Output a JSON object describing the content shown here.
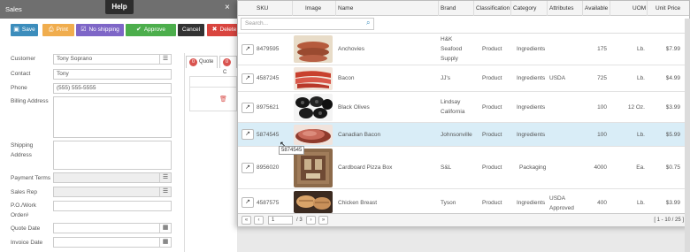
{
  "window": {
    "title": "Sales",
    "help_tab": "Help",
    "close_glyph": "×"
  },
  "toolbar": {
    "save": "Save",
    "print": "Print",
    "no_shipping": "No shipping",
    "approve": "Approve",
    "cancel": "Cancel",
    "delete": "Delete"
  },
  "form": {
    "customer_label": "Customer",
    "customer_value": "Tony Soprano",
    "contact_label": "Contact",
    "contact_value": "Tony",
    "phone_label": "Phone",
    "phone_value": "(555) 555-5555",
    "billing_label": "Billing Address",
    "shipping_label_1": "Shipping",
    "shipping_label_2": "Address",
    "payment_label": "Payment Terms",
    "salesrep_label": "Sales Rep",
    "po_label_1": "P.O./Work",
    "po_label_2": "Order#",
    "quote_date_label": "Quote Date",
    "invoice_date_label": "Invoice Date"
  },
  "tabs": {
    "quote_count": "0",
    "quote_label": "Quote",
    "second_count": "0",
    "second_label": "C"
  },
  "grid": {
    "headers": {
      "sku": "SKU",
      "image": "Image",
      "name": "Name",
      "brand": "Brand",
      "classification": "Classification",
      "category": "Category",
      "attributes": "Attributes",
      "available": "Available",
      "uom": "UOM",
      "unit_price": "Unit Price"
    },
    "search_placeholder": "Search...",
    "rows": [
      {
        "sku": "8479595",
        "name": "Anchovies",
        "brand_1": "H&K",
        "brand_2": "Seafood",
        "brand_3": "Supply",
        "classification": "Product",
        "category": "Ingredients",
        "attributes": "",
        "available": "175",
        "uom": "Lb.",
        "price": "$7.99"
      },
      {
        "sku": "4587245",
        "name": "Bacon",
        "brand_1": "JJ's",
        "brand_2": "",
        "brand_3": "",
        "classification": "Product",
        "category": "Ingredients",
        "attributes": "USDA",
        "available": "725",
        "uom": "Lb.",
        "price": "$4.99"
      },
      {
        "sku": "8975621",
        "name": "Black Olives",
        "brand_1": "Lindsay",
        "brand_2": "California",
        "brand_3": "",
        "classification": "Product",
        "category": "Ingredients",
        "attributes": "",
        "available": "100",
        "uom": "12 Oz.",
        "price": "$3.99"
      },
      {
        "sku": "5874545",
        "name": "Canadian Bacon",
        "brand_1": "Johnsonville",
        "brand_2": "",
        "brand_3": "",
        "classification": "Product",
        "category": "Ingredients",
        "attributes": "",
        "available": "100",
        "uom": "Lb.",
        "price": "$5.99"
      },
      {
        "sku": "8956020",
        "name": "Cardboard Pizza Box",
        "brand_1": "S&L",
        "brand_2": "",
        "brand_3": "",
        "classification": "Product",
        "category": "Packaging",
        "attributes": "",
        "available": "4000",
        "uom": "Ea.",
        "price": "$0.75"
      },
      {
        "sku": "4587575",
        "name": "Chicken Breast",
        "brand_1": "Tyson",
        "brand_2": "",
        "brand_3": "",
        "classification": "Product",
        "category": "Ingredients",
        "attributes_1": "USDA",
        "attributes_2": "Approved",
        "available": "400",
        "uom": "Lb.",
        "price": "$3.99"
      }
    ],
    "tooltip": "5874545"
  },
  "pager": {
    "first": "«",
    "prev": "‹",
    "page": "1",
    "of": "/ 3",
    "next": "›",
    "last": "»",
    "info": "[ 1 - 10 / 25 ]"
  },
  "colors": {
    "save": "#3c8dbc",
    "print": "#f0ad4e",
    "noship": "#7e66c7",
    "approve": "#4cae4c",
    "cancel": "#333333",
    "delete": "#d9453f",
    "selected_row": "#d9edf7"
  },
  "icons": [
    "save-icon",
    "print-icon",
    "no-shipping-icon",
    "check-icon",
    "close-icon",
    "trash-icon",
    "list-icon",
    "calendar-icon",
    "external-link-icon",
    "search-icon"
  ]
}
